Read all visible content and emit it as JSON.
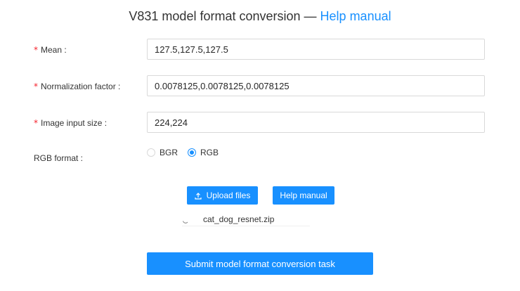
{
  "header": {
    "title": "V831 model format conversion —",
    "help_link": "Help manual"
  },
  "form": {
    "mean": {
      "label": "Mean :",
      "required": true,
      "value": "127.5,127.5,127.5"
    },
    "normalization": {
      "label": "Normalization factor :",
      "required": true,
      "value": "0.0078125,0.0078125,0.0078125"
    },
    "image_size": {
      "label": "Image input size :",
      "required": true,
      "value": "224,224"
    },
    "rgb_format": {
      "label": "RGB format :",
      "options": [
        "BGR",
        "RGB"
      ],
      "selected": "RGB"
    }
  },
  "buttons": {
    "upload": "Upload files",
    "help": "Help manual",
    "submit": "Submit model format conversion task"
  },
  "file": {
    "name": "cat_dog_resnet.zip"
  },
  "icons": {
    "required_mark": "*",
    "upload_icon": "upload-icon",
    "loading_icon": "spinner-icon"
  },
  "colors": {
    "accent": "#1890ff",
    "required": "#f5222d"
  }
}
